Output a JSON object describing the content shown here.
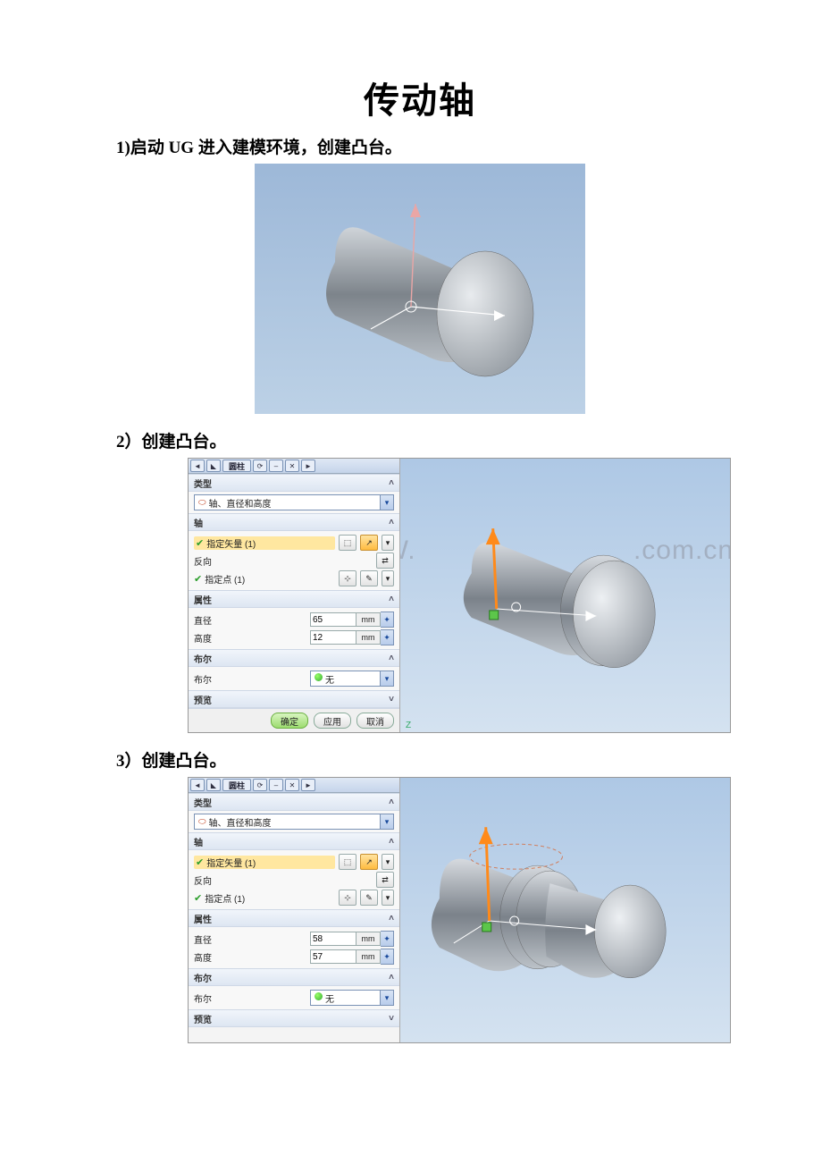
{
  "title": "传动轴",
  "steps": {
    "s1": {
      "num": "1)",
      "text": "启动 UG 进入建模环境，创建凸台。"
    },
    "s2": {
      "num": "2）",
      "text": "创建凸台。"
    },
    "s3": {
      "num": "3）",
      "text": "创建凸台。"
    }
  },
  "dialog": {
    "title": "圆柱",
    "sections": {
      "type": "类型",
      "axis": "轴",
      "attr": "属性",
      "bool": "布尔",
      "preview": "预览"
    },
    "type_combo": "轴、直径和高度",
    "rows": {
      "vector": "指定矢量 (1)",
      "reverse": "反向",
      "point": "指定点 (1)",
      "diameter": "直径",
      "height": "高度",
      "bool": "布尔"
    },
    "unit": "mm",
    "bool_value": "无",
    "buttons": {
      "ok": "确定",
      "apply": "应用",
      "cancel": "取消"
    }
  },
  "fig2": {
    "diameter": "65",
    "height": "12"
  },
  "fig3": {
    "diameter": "58",
    "height": "57"
  },
  "watermark_left": "WWW.",
  "watermark_right": ".com.cn",
  "axis_label": "Z"
}
